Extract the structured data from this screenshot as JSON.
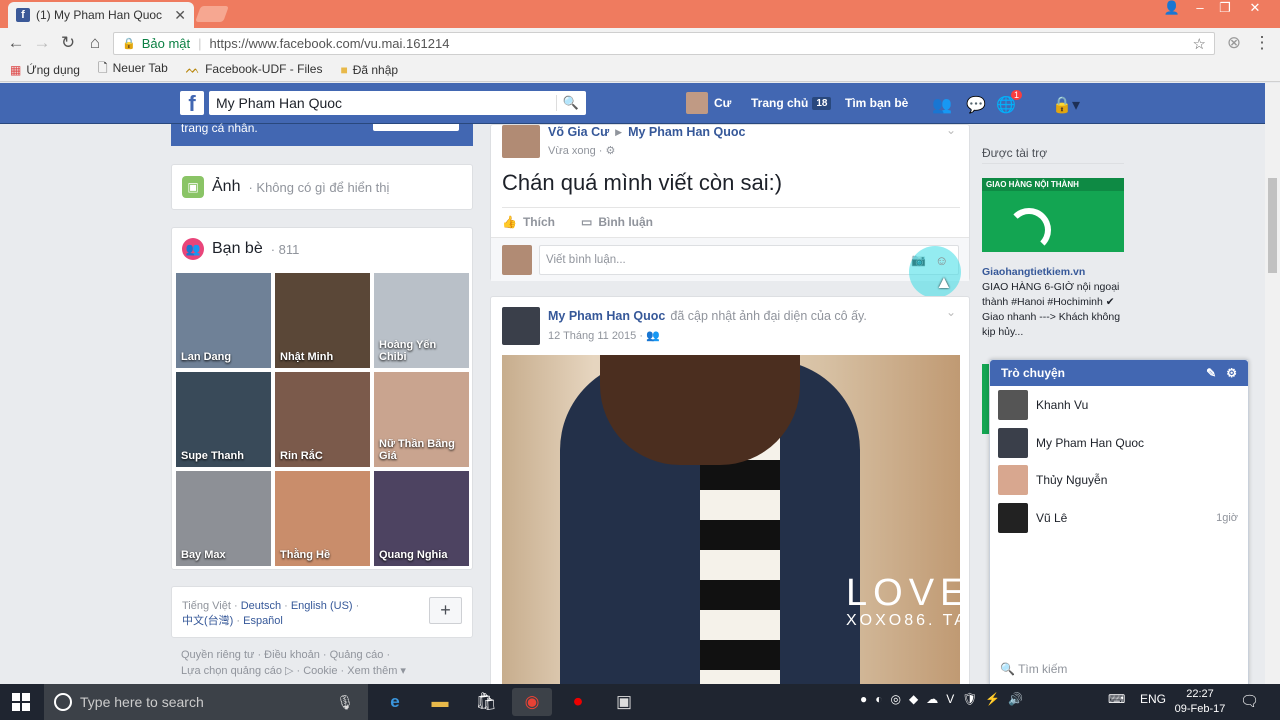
{
  "browser": {
    "tab_title": "(1) My Pham Han Quoc",
    "tab_close": "✕",
    "secure_label": "Bảo mật",
    "url": "https://www.facebook.com/vu.mai.161214",
    "bookmarks": [
      {
        "label": "Ứng dụng",
        "icon": "apps-icon"
      },
      {
        "label": "Neuer Tab",
        "icon": "page-icon"
      },
      {
        "label": "Facebook-UDF - Files",
        "icon": "udf-icon"
      },
      {
        "label": "Đã nhập",
        "icon": "folder-icon"
      }
    ]
  },
  "fb_header": {
    "logo": "f",
    "search_value": "My Pham Han Quoc",
    "user_name": "Cư",
    "home_label": "Trang chủ",
    "home_count": "18",
    "find_friends_label": "Tìm bạn bè",
    "notif_count": "1"
  },
  "left": {
    "cover_text": "trang cá nhân.",
    "photos_label": "Ảnh",
    "photos_note": "· Không có gì để hiển thị",
    "friends_label": "Bạn bè",
    "friends_count": "· 811",
    "friends": [
      {
        "name": "Lan Dang",
        "color": "#6f8197"
      },
      {
        "name": "Nhật Minh",
        "color": "#5a4737"
      },
      {
        "name": "Hoàng Yến Chibi",
        "color": "#b9c0c8"
      },
      {
        "name": "Supe Thanh",
        "color": "#394a59"
      },
      {
        "name": "Rin RắC",
        "color": "#7b5a4b"
      },
      {
        "name": "Nữ Thần Băng Giá",
        "color": "#c9a48f"
      },
      {
        "name": "Bay Max",
        "color": "#8d9096"
      },
      {
        "name": "Thằng Hề",
        "color": "#c98d6b"
      },
      {
        "name": "Quang Nghia",
        "color": "#4d4361"
      }
    ],
    "languages": {
      "current": "Tiếng Việt",
      "others": [
        "Deutsch",
        "English (US)",
        "中文(台灣)",
        "Español"
      ]
    },
    "footer_line1": "Quyền riêng tư · Điều khoản · Quảng cáo ·",
    "footer_line2": "Lựa chọn quảng cáo ▷ · Cookie · Xem thêm ▾"
  },
  "post1": {
    "author": "Võ Gia Cư",
    "arrow": "▶",
    "target": "My Pham Han Quoc",
    "time": "Vừa xong · ⚙",
    "text": "Chán quá mình viết còn sai:)",
    "like_label": "Thích",
    "comment_label": "Bình luận",
    "comment_placeholder": "Viết bình luận..."
  },
  "post2": {
    "author": "My Pham Han Quoc",
    "action": "đã cập nhật ảnh đại diện của cô ấy.",
    "time": "12 Tháng 11 2015 · ",
    "overlay_big": "LOVE",
    "overlay_small": "XOXO86. TA"
  },
  "right": {
    "sponsored": "Được tài trợ",
    "ad_domain": "Giaohangtietkiem.vn",
    "ad_text": "GIAO HÀNG 6-GIỜ nội ngoại thành #Hanoi #Hochiminh ✔ Giao nhanh ---> Khách không kịp hủy...",
    "ad_img_title": "GIAO HÀNG NỘI THÀNH"
  },
  "chat": {
    "title": "Trò chuyện",
    "contacts": [
      {
        "name": "Khanh Vu",
        "time": "",
        "color": "#555"
      },
      {
        "name": "My Pham Han Quoc",
        "time": "",
        "color": "#3a3f4a"
      },
      {
        "name": "Thủy Nguyễn",
        "time": "",
        "color": "#d8a78f"
      },
      {
        "name": "Vũ Lê",
        "time": "1giờ",
        "color": "#222"
      }
    ],
    "search_placeholder": "Tìm kiếm"
  },
  "taskbar": {
    "search_placeholder": "Type here to search",
    "lang": "ENG",
    "time": "22:27",
    "date": "09-Feb-17"
  }
}
